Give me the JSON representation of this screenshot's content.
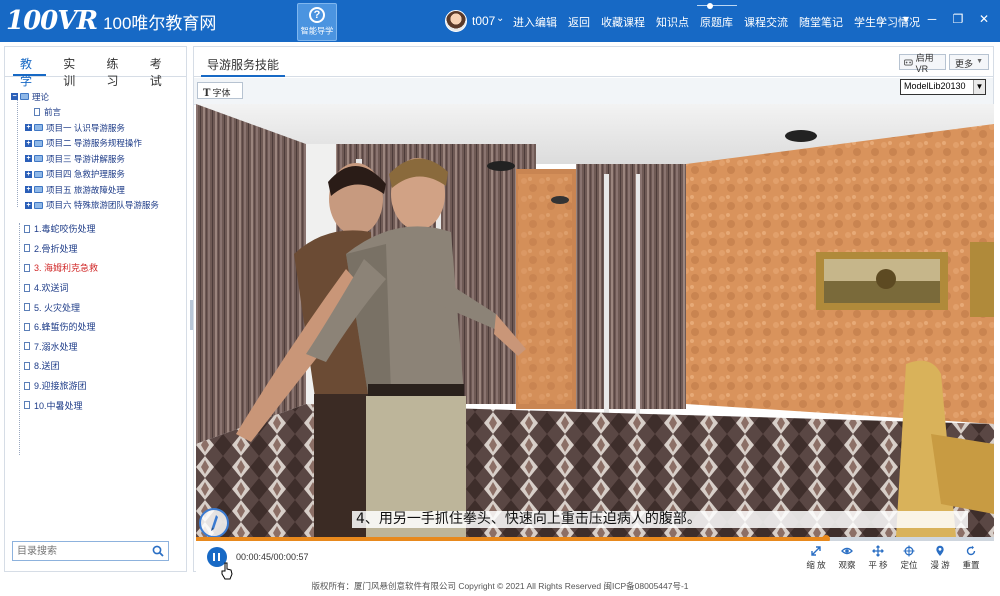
{
  "app": {
    "logo_mark": "100VR",
    "logo_text": "100唯尔教育网",
    "smart_guide_label": "智能导学",
    "username": "t007",
    "nav": [
      "进入编辑",
      "返回",
      "收藏课程",
      "知识点",
      "原题库",
      "课程交流",
      "随堂笔记",
      "学生学习情况"
    ],
    "window_controls": [
      "home-icon",
      "download-icon",
      "minimize-icon",
      "restore-icon",
      "close-icon"
    ]
  },
  "sidebar": {
    "tabs": [
      "教学",
      "实训",
      "练习",
      "考试"
    ],
    "active_tab": "教学",
    "tree": {
      "root": "理论",
      "preface": "前言",
      "projects": [
        "项目一 认识导游服务",
        "项目二 导游服务规程操作",
        "项目三 导游讲解服务",
        "项目四 急救护理服务",
        "项目五 旅游故障处理",
        "项目六 特殊旅游团队导游服务"
      ]
    },
    "lessons": [
      {
        "label": "1.毒蛇咬伤处理",
        "active": false
      },
      {
        "label": "2.骨折处理",
        "active": false
      },
      {
        "label": "3. 海姆利克急救",
        "active": true
      },
      {
        "label": "4.欢送词",
        "active": false
      },
      {
        "label": "5. 火灾处理",
        "active": false
      },
      {
        "label": "6.蜂蜇伤的处理",
        "active": false
      },
      {
        "label": "7.溺水处理",
        "active": false
      },
      {
        "label": "8.送团",
        "active": false
      },
      {
        "label": "9.迎接旅游团",
        "active": false
      },
      {
        "label": "10.中暑处理",
        "active": false
      }
    ],
    "search_placeholder": "目录搜索"
  },
  "main": {
    "tab": "导游服务技能",
    "vr_button": "启用VR",
    "more_button": "更多",
    "font_button": "字体",
    "model_select": "ModelLib20130",
    "subtitle": "4、用另一手抓住拳头、快速向上重击压迫病人的腹部。",
    "time": "00:00:45/00:00:57",
    "progress_fraction": 0.79,
    "controls": [
      {
        "label": "缩 放",
        "icon": "zoom-icon"
      },
      {
        "label": "观察",
        "icon": "eye-icon"
      },
      {
        "label": "平 移",
        "icon": "pan-icon"
      },
      {
        "label": "定位",
        "icon": "target-icon"
      },
      {
        "label": "漫 游",
        "icon": "roam-icon"
      },
      {
        "label": "重置",
        "icon": "reset-icon"
      }
    ]
  },
  "footer": "版权所有：厦门风悬创意软件有限公司   Copyright © 2021    All Rights Reserved   闽ICP备08005447号-1",
  "colors": {
    "brand_blue": "#1769c5",
    "active_lesson": "#d12a2a",
    "progress": "#e8891d"
  }
}
